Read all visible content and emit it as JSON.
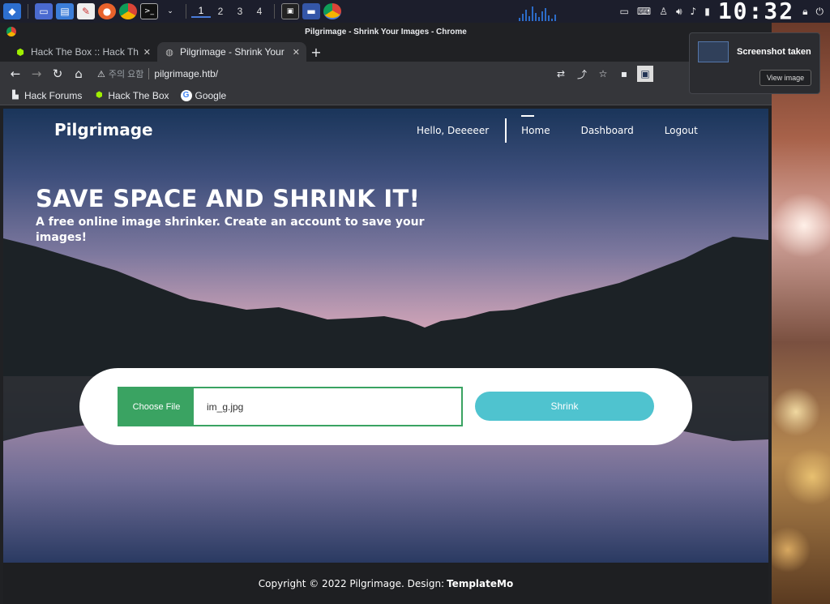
{
  "taskbar": {
    "workspaces": [
      "1",
      "2",
      "3",
      "4"
    ],
    "clock": "10:32",
    "apps": [
      "app-menu-icon",
      "desktop-icon",
      "file-manager-icon",
      "text-editor-icon",
      "firefox-icon",
      "chrome-icon",
      "terminal-icon"
    ]
  },
  "window": {
    "title": "Pilgrimage - Shrink Your Images - Chrome"
  },
  "tabs": [
    {
      "label": "Hack The Box :: Hack The B",
      "close": "✕"
    },
    {
      "label": "Pilgrimage - Shrink Your I",
      "close": "✕"
    }
  ],
  "new_tab": "+",
  "omnibox": {
    "warning": "주의 요함",
    "url": "pilgrimage.htb/"
  },
  "bookmarks": [
    {
      "label": "Hack Forums"
    },
    {
      "label": "Hack The Box"
    },
    {
      "label": "Google"
    }
  ],
  "site": {
    "logo": "Pilgrimage",
    "nav": {
      "hello": "Hello, Deeeeer",
      "home": "Home",
      "dashboard": "Dashboard",
      "logout": "Logout"
    },
    "hero_title": "SAVE SPACE AND SHRINK IT!",
    "hero_subtitle": "A free online image shrinker. Create an account to save your images!",
    "upload": {
      "choose_file": "Choose File",
      "file_name": "im_g.jpg",
      "shrink": "Shrink"
    },
    "footer": {
      "text": "Copyright © 2022 Pilgrimage. Design:",
      "link": "TemplateMo"
    }
  },
  "notification": {
    "title": "Screenshot taken",
    "button": "View image"
  },
  "colors": {
    "accent_green": "#3aa362",
    "shrink_button": "#4fc3cf"
  }
}
